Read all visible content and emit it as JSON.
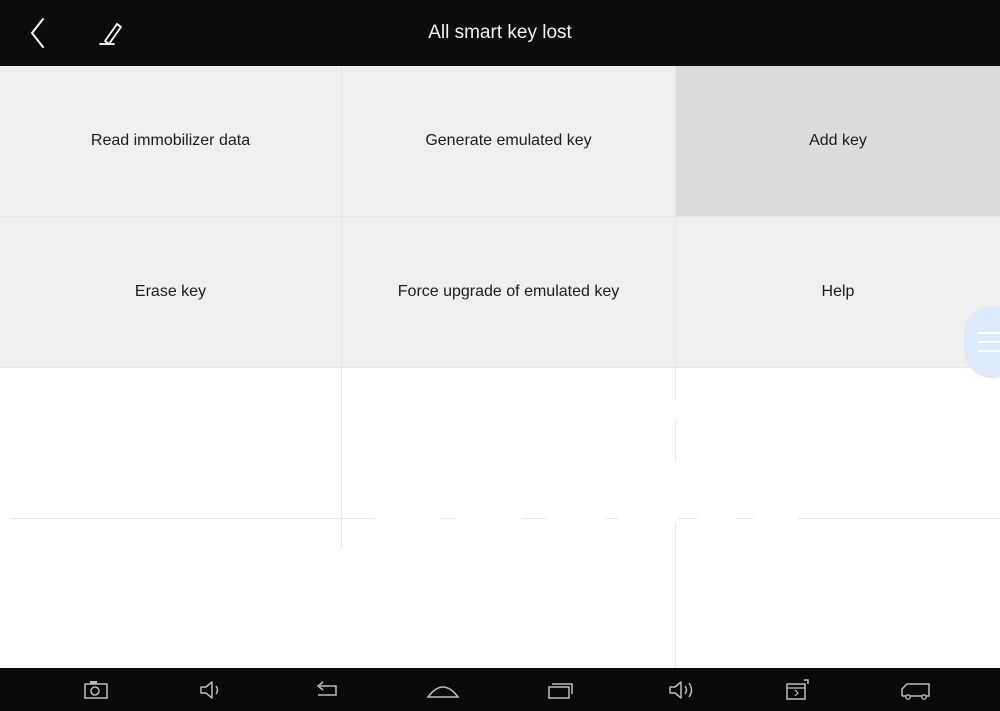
{
  "header": {
    "title": "All smart key lost",
    "back_icon": "chevron-left-icon",
    "edit_icon": "pencil-icon"
  },
  "menu": {
    "items": [
      {
        "label": "Read immobilizer data",
        "state": "normal"
      },
      {
        "label": "Generate emulated key",
        "state": "normal"
      },
      {
        "label": "Add key",
        "state": "selected"
      },
      {
        "label": "Erase key",
        "state": "normal"
      },
      {
        "label": "Force upgrade of emulated key",
        "state": "normal"
      },
      {
        "label": "Help",
        "state": "normal"
      }
    ]
  },
  "navbar": {
    "icons": [
      "screenshot-icon",
      "volume-down-icon",
      "back-icon",
      "home-icon",
      "recent-apps-icon",
      "volume-up-icon",
      "vci-icon",
      "truck-icon"
    ]
  },
  "colors": {
    "header_bg": "#0d0d0d",
    "cell_bg": "#efefef",
    "cell_selected_bg": "#dcdcdc",
    "navbar_bg": "#0a0a0a",
    "float_button": "#dbe9f8"
  }
}
